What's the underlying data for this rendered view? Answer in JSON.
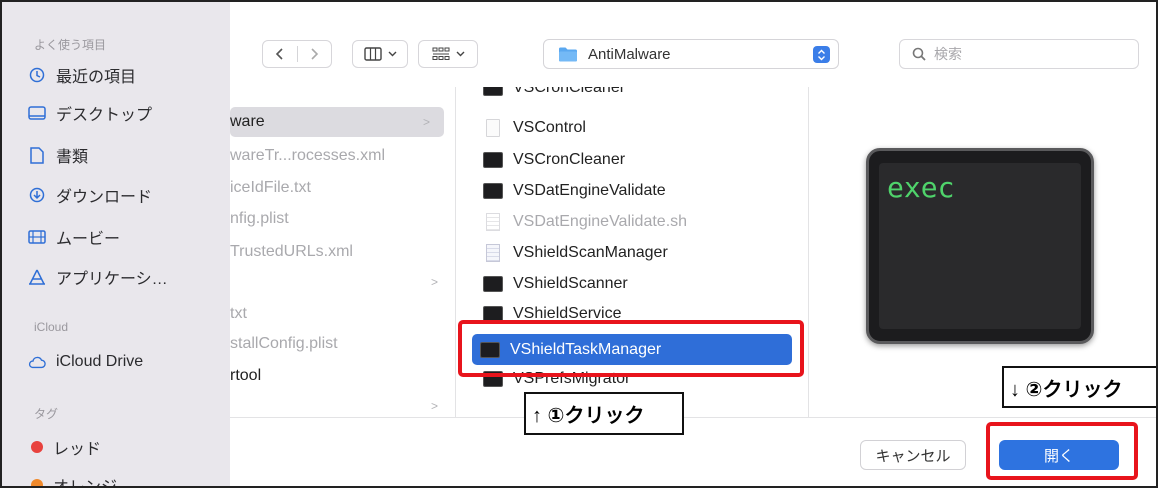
{
  "sidebar": {
    "favorites_header": "よく使う項目",
    "favorites": [
      {
        "label": "最近の項目",
        "icon": "clock-icon"
      },
      {
        "label": "デスクトップ",
        "icon": "desktop-icon"
      },
      {
        "label": "書類",
        "icon": "document-icon"
      },
      {
        "label": "ダウンロード",
        "icon": "download-icon"
      },
      {
        "label": "ムービー",
        "icon": "film-icon"
      },
      {
        "label": "アプリケーシ…",
        "icon": "applications-icon"
      }
    ],
    "icloud_header": "iCloud",
    "icloud": [
      {
        "label": "iCloud Drive",
        "icon": "cloud-icon"
      }
    ],
    "tags_header": "タグ",
    "tags": [
      {
        "label": "レッド",
        "color": "#e8423e"
      },
      {
        "label": "オレンジ",
        "color": "#f0892b"
      }
    ]
  },
  "toolbar": {
    "path_folder": "AntiMalware",
    "search_placeholder": "検索"
  },
  "column_a": [
    {
      "label": "ware",
      "selected": true,
      "dim": false,
      "has_children": true
    },
    {
      "label": "wareTr...rocesses.xml",
      "selected": false,
      "dim": true,
      "has_children": false
    },
    {
      "label": "iceIdFile.txt",
      "selected": false,
      "dim": true,
      "has_children": false
    },
    {
      "label": "nfig.plist",
      "selected": false,
      "dim": true,
      "has_children": false
    },
    {
      "label": "TrustedURLs.xml",
      "selected": false,
      "dim": true,
      "has_children": false
    },
    {
      "label": "",
      "selected": false,
      "dim": true,
      "has_children": true
    },
    {
      "label": "txt",
      "selected": false,
      "dim": true,
      "has_children": false
    },
    {
      "label": "stallConfig.plist",
      "selected": false,
      "dim": true,
      "has_children": false
    },
    {
      "label": "rtool",
      "selected": false,
      "dim": false,
      "has_children": false
    },
    {
      "label": "",
      "selected": false,
      "dim": true,
      "has_children": true
    }
  ],
  "column_b": [
    {
      "label": "VSCronCleaner",
      "type": "exec",
      "dim": false,
      "selected": false
    },
    {
      "label": "VSControl",
      "type": "doc",
      "dim": false,
      "selected": false
    },
    {
      "label": "VSCronCleaner",
      "type": "exec",
      "dim": false,
      "selected": false
    },
    {
      "label": "VSDatEngineValidate",
      "type": "exec",
      "dim": false,
      "selected": false
    },
    {
      "label": "VSDatEngineValidate.sh",
      "type": "sh",
      "dim": true,
      "selected": false
    },
    {
      "label": "VShieldScanManager",
      "type": "app",
      "dim": false,
      "selected": false
    },
    {
      "label": "VShieldScanner",
      "type": "exec",
      "dim": false,
      "selected": false
    },
    {
      "label": "VShieldService",
      "type": "exec",
      "dim": false,
      "selected": false
    },
    {
      "label": "VShieldTaskManager",
      "type": "exec",
      "dim": false,
      "selected": true
    },
    {
      "label": "VSPrefsMigrator",
      "type": "exec",
      "dim": false,
      "selected": false
    }
  ],
  "preview": {
    "icon_text": "exec"
  },
  "buttons": {
    "cancel": "キャンセル",
    "open": "開く"
  },
  "annotations": {
    "step1": "↑ ①クリック",
    "step2": "↓ ②クリック",
    "highlight_color": "#e8141c"
  }
}
